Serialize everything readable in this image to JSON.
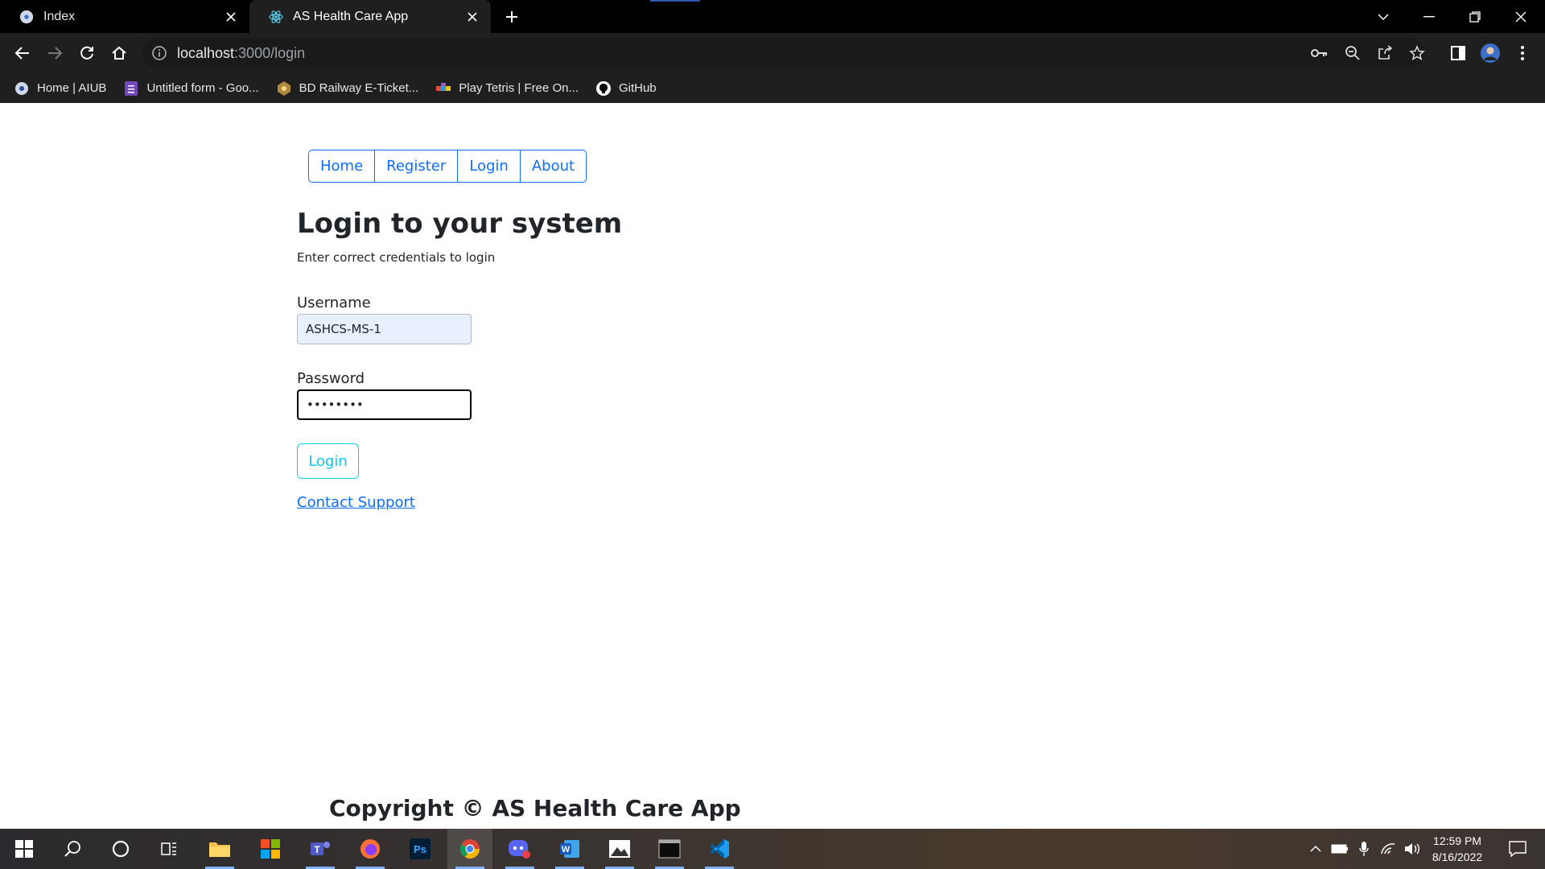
{
  "browser": {
    "tabs": [
      {
        "title": "Index",
        "icon": "react-logo-icon"
      },
      {
        "title": "AS Health Care App",
        "icon": "react-logo-icon",
        "active": true
      }
    ],
    "url_host": "localhost",
    "url_path": ":3000/login",
    "bookmarks": [
      {
        "label": "Home | AIUB",
        "icon": "aiub-icon"
      },
      {
        "label": "Untitled form - Goo...",
        "icon": "google-forms-icon"
      },
      {
        "label": "BD Railway E-Ticket...",
        "icon": "railway-icon"
      },
      {
        "label": "Play Tetris | Free On...",
        "icon": "tetris-icon"
      },
      {
        "label": "GitHub",
        "icon": "github-icon"
      }
    ]
  },
  "page": {
    "nav": [
      "Home",
      "Register",
      "Login",
      "About"
    ],
    "title": "Login to your system",
    "subtitle": "Enter correct credentials to login",
    "username_label": "Username",
    "username_value": "ASHCS-MS-1",
    "password_label": "Password",
    "password_value": "••••••••",
    "login_button": "Login",
    "support_link": "Contact Support",
    "footer": "Copyright © AS Health Care App"
  },
  "taskbar": {
    "time": "12:59 PM",
    "date": "8/16/2022"
  },
  "colors": {
    "primary": "#0d6efd",
    "info": "#0dcaf0",
    "autofill": "#e8f0fe"
  }
}
